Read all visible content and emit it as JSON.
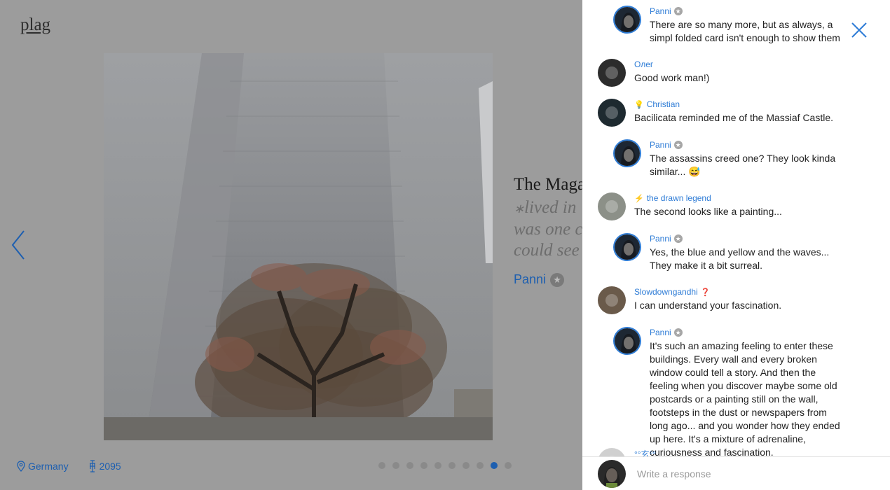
{
  "logo": "plag",
  "caption": {
    "title": "The Maga",
    "quote_lines": [
      "lived in",
      "was one c",
      "could see"
    ],
    "author": "Panni"
  },
  "footer": {
    "location": "Germany",
    "views": "2095"
  },
  "pager": {
    "count": 10,
    "active_index": 8
  },
  "comments": [
    {
      "name": "Panni",
      "reply": true,
      "star": true,
      "text": "There are so many more, but as always, a simpl folded card isn't enough to show them"
    },
    {
      "name": "Олег",
      "reply": false,
      "star": false,
      "text": "Good work man!)"
    },
    {
      "name": "Christian",
      "reply": false,
      "star": false,
      "prefix": "💡",
      "text": "Bacilicata reminded me of the Massiaf Castle."
    },
    {
      "name": "Panni",
      "reply": true,
      "star": true,
      "text": "The assassins creed one? They look kinda similar... 😅"
    },
    {
      "name": "the drawn legend",
      "reply": false,
      "star": false,
      "prefix": "⚡",
      "text": "The second looks like a painting..."
    },
    {
      "name": "Panni",
      "reply": true,
      "star": true,
      "text": "Yes, the blue and yellow and the waves... They make it a bit surreal."
    },
    {
      "name": "Slowdowngandhi",
      "reply": false,
      "star": false,
      "suffix": "❓",
      "text": "I can understand your fascination."
    },
    {
      "name": "Panni",
      "reply": true,
      "star": true,
      "text": "It's such an amazing feeling to enter these buildings. Every wall and every broken window could tell a story. And then the feeling when you discover maybe some old postcards or a painting still on the wall, footsteps in the dust or newspapers from long ago... and you wonder how they ended up here. It's a mixture of adrenaline, curiousness and fascination."
    },
    {
      "name": "°°玄°°",
      "reply": false,
      "star": false,
      "text": ""
    }
  ],
  "respond": {
    "placeholder": "Write a response"
  },
  "colors": {
    "accent": "#2e7cd6",
    "link": "#1d5fb0"
  }
}
